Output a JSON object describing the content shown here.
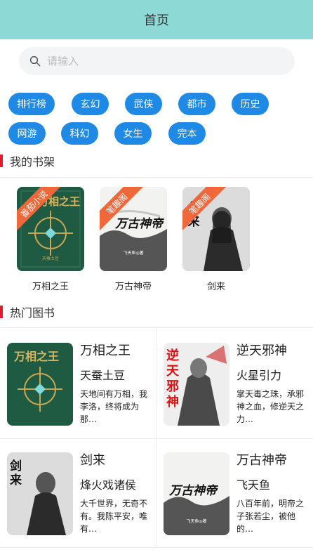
{
  "header": {
    "title": "首页"
  },
  "search": {
    "placeholder": "请输入"
  },
  "categories": [
    "排行榜",
    "玄幻",
    "武侠",
    "都市",
    "历史",
    "网游",
    "科幻",
    "女生",
    "完本"
  ],
  "shelf": {
    "title": "我的书架",
    "books": [
      {
        "name": "万相之王",
        "tag": "番茄小说",
        "cover_title": "万相之王"
      },
      {
        "name": "万古神帝",
        "tag": "笔趣阁",
        "cover_title": "万古神帝"
      },
      {
        "name": "剑来",
        "tag": "笔趣阁",
        "cover_title": "剑来"
      }
    ]
  },
  "hot": {
    "title": "热门图书",
    "books": [
      {
        "title": "万相之王",
        "author": "天蚕土豆",
        "desc": "天地间有万相，我李洛，终将成为那…",
        "cover_title": "万相之王"
      },
      {
        "title": "逆天邪神",
        "author": "火星引力",
        "desc": "掌天毒之珠，承邪神之血，修逆天之力…",
        "cover_title": "逆天邪神"
      },
      {
        "title": "剑来",
        "author": "烽火戏诸侯",
        "desc": "大千世界，无奇不有。我陈平安，唯有…",
        "cover_title": "剑来"
      },
      {
        "title": "万古神帝",
        "author": "飞天鱼",
        "desc": "八百年前，明帝之子张若尘，被他的…",
        "cover_title": "万古神帝"
      }
    ]
  },
  "colors": {
    "header_bg": "#8dd9d6",
    "accent": "#1f8ae6",
    "section_bar": "#e8192c",
    "ribbon": "#f0673a"
  }
}
